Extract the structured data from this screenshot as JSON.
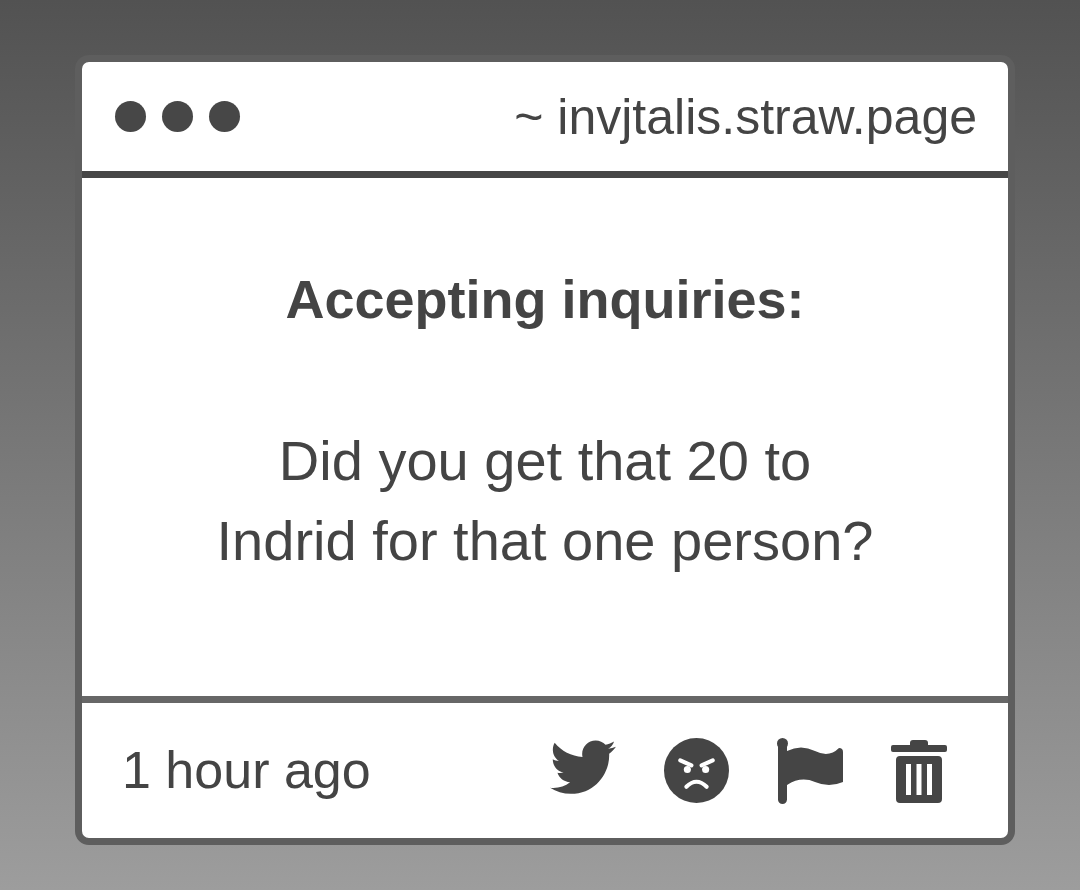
{
  "window": {
    "title": "~ invjtalis.straw.page"
  },
  "message": {
    "heading": "Accepting inquiries:",
    "body": "Did you get that 20 to\nIndrid for that one person?"
  },
  "footer": {
    "time": "1 hour ago"
  }
}
